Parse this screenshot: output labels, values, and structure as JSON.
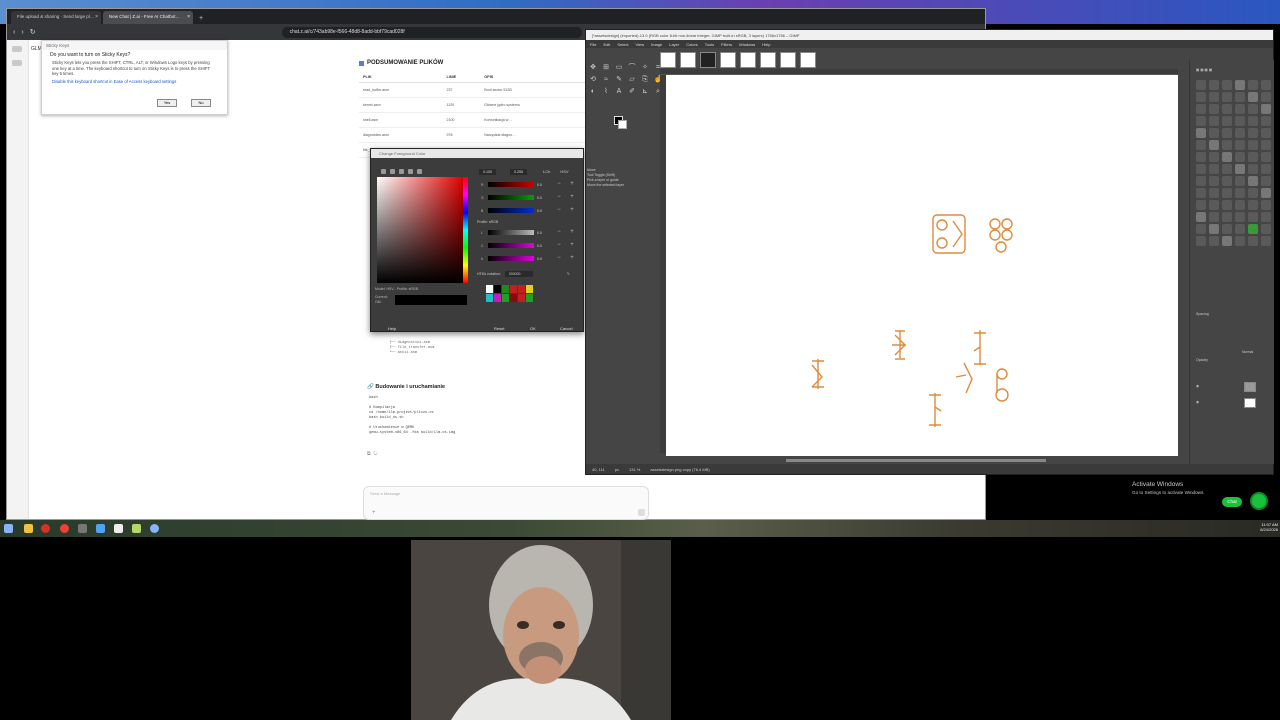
{
  "browser": {
    "tabs": [
      {
        "label": "File upload & sharing · Send large pl…"
      },
      {
        "label": "New Chat | Z.ai - Free AI Chatbot…"
      }
    ],
    "url": "chat.z.ai/c/743ab98e-f566-48d8-8add-bbf79cad028f",
    "new_tab": "+"
  },
  "sidebar_label": "GLM",
  "sticky_keys": {
    "title": "Sticky Keys",
    "question": "Do you want to turn on Sticky Keys?",
    "description": "Sticky Keys lets you press the SHIFT, CTRL, ALT, or Windows Logo keys by pressing one key at a time. The keyboard shortcut to turn on Sticky Keys is to press the SHIFT key 5 times.",
    "link": "Disable this keyboard shortcut in Ease of Access keyboard settings",
    "yes": "Yes",
    "no": "No"
  },
  "chat": {
    "heading": "PODSUMOWANIE PLIKÓW",
    "table_headers": [
      "PLIK",
      "LINIE",
      "OPIS"
    ],
    "rows": [
      [
        "read_buffer.asm",
        "237",
        "Boot sector 512B"
      ],
      [
        "kernel.asm",
        "1120",
        "Główne jądro systemu"
      ],
      [
        "shell.asm",
        "2100",
        "Komunikacja w…"
      ],
      [
        "diagnostics.asm",
        "978",
        "Narzędzia diagno…"
      ],
      [
        "file_transfer.asm",
        "480",
        "Transfer plików"
      ]
    ],
    "tree": [
      "├── diagnostics.asm",
      "├── file_transfer.asm",
      "└── ascii.asm"
    ],
    "build_heading": "Budowanie i uruchamianie",
    "code": [
      "bash",
      "",
      "# Kompilacja",
      "cd /home/ilm-project/pliczu.os",
      "bash build_os.sh",
      "",
      "# Uruchomienie w QEMU",
      "qemu-system-x86_64 -fda build/ilm-os.img"
    ],
    "input_placeholder": "Send a Message"
  },
  "color_dialog": {
    "title": "Change Foreground Color",
    "input_a": "0.100",
    "input_b": "0.255",
    "mode_a": "LCh",
    "mode_b": "HSV",
    "sliders": [
      {
        "label": "R",
        "value": "0.0",
        "color": "#d00000"
      },
      {
        "label": "G",
        "value": "0.0",
        "color": "#00a000"
      },
      {
        "label": "B",
        "value": "0.0",
        "color": "#0030d0"
      },
      {
        "label": "L",
        "value": "0.0",
        "color": "#bbbbbb"
      },
      {
        "label": "C",
        "value": "0.0",
        "color": "#e000e0"
      },
      {
        "label": "h",
        "value": "0.0",
        "color": "#e000e0"
      }
    ],
    "profile": "Profile: sRGB",
    "hex_label": "HTML notation:",
    "hex_value": "000000",
    "model": "Model: HSV - Profile: sRGB",
    "current": "Current:",
    "old": "Old:",
    "buttons": {
      "help": "Help",
      "reset": "Reset",
      "ok": "OK",
      "cancel": "Cancel"
    },
    "history": [
      "#ffffff",
      "#000000",
      "#1e8a1e",
      "#c02020",
      "#c02020",
      "#e0d020",
      "#20c0c0",
      "#c020c0",
      "#20a020",
      "#801010",
      "#c02020",
      "#20a020"
    ]
  },
  "gimp": {
    "title": "[*assetsdesign] (imported)-13.0 (RGB color 8-bit non-linear integer, GIMP built-in sRGB, 3 layers) 1756x1756 – GIMP",
    "menu": [
      "File",
      "Edit",
      "Select",
      "View",
      "Image",
      "Layer",
      "Colors",
      "Tools",
      "Filters",
      "Windows",
      "Help"
    ],
    "tool_options": [
      "Move",
      "Tool Toggle (Shift)",
      "Pick a layer or guide",
      "Move the selected layer"
    ],
    "status": [
      "40, 111",
      "px",
      "131 %",
      "assetsdesign.png copy (76.4 MB)"
    ],
    "dock_spacing": "Spacing",
    "dock_mode": "Normal",
    "dock_opacity": "Opacity",
    "accent": "#e08a3c"
  },
  "activate_windows": {
    "title": "Activate Windows",
    "subtitle": "Go to Settings to activate Windows."
  },
  "tray": {
    "chat": "Chat",
    "time": "11:07 AM",
    "date": "6/24/2026"
  }
}
